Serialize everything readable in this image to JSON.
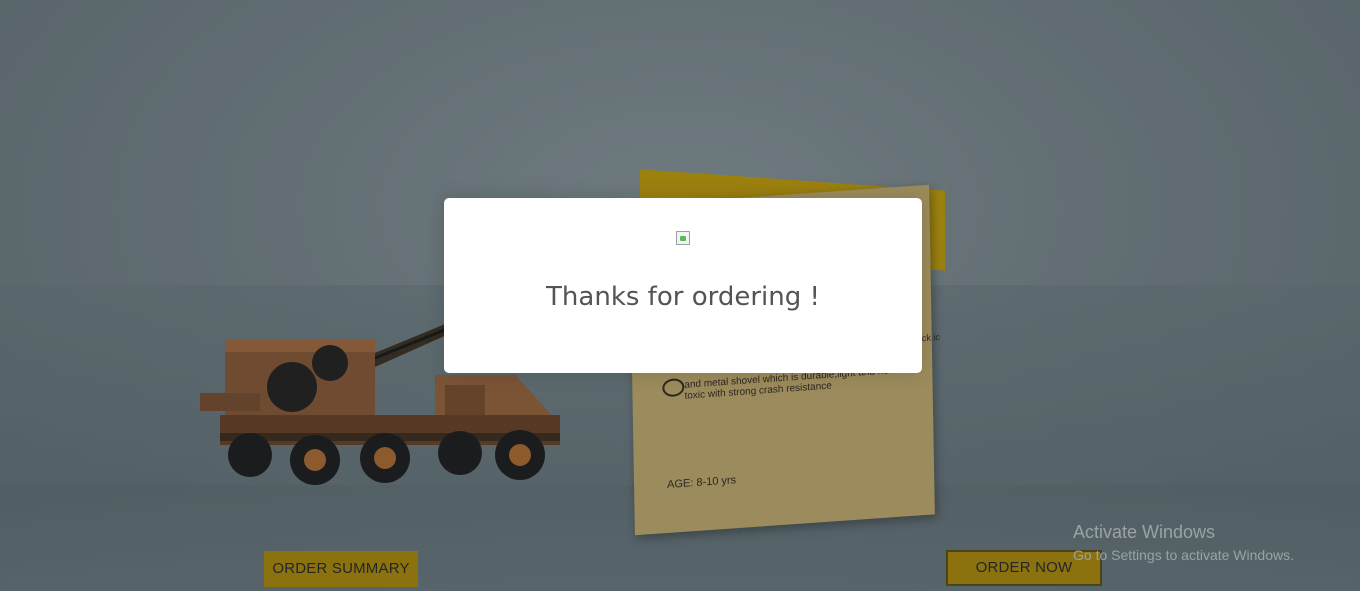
{
  "product_card": {
    "description": "and metal shovel which is durable,light and non-toxic with strong crash resistance",
    "age": "AGE: 8-10 yrs",
    "edge_text": "ck\nic"
  },
  "buttons": {
    "order_summary": "ORDER SUMMARY",
    "order_now": "ORDER NOW"
  },
  "watermark": {
    "title": "Activate Windows",
    "subtitle": "Go to Settings to activate Windows."
  },
  "modal": {
    "image_icon": "broken-image-icon",
    "message": "Thanks for ordering !"
  },
  "colors": {
    "button_bg": "#b38a00",
    "card_bg": "#c9ad6b",
    "modal_bg": "#ffffff"
  }
}
